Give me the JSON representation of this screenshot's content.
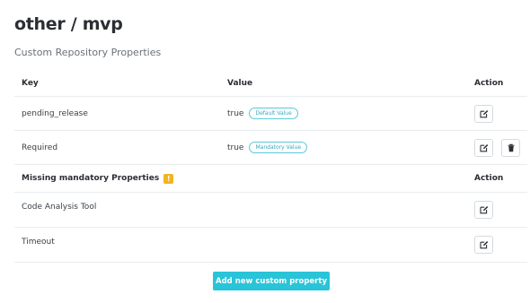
{
  "page": {
    "title": "other / mvp",
    "subtitle": "Custom Repository Properties"
  },
  "table": {
    "headers": {
      "key": "Key",
      "value": "Value",
      "action": "Action"
    },
    "rows": [
      {
        "key": "pending_release",
        "value": "true",
        "badge": "Default Value"
      },
      {
        "key": "Required",
        "value": "true",
        "badge": "Mandatory Value"
      }
    ]
  },
  "missing": {
    "title": "Missing mandatory Properties",
    "warning_icon": "!",
    "action_header": "Action",
    "rows": [
      {
        "key": "Code Analysis Tool"
      },
      {
        "key": "Timeout"
      }
    ]
  },
  "actions": {
    "add_label": "Add new custom property"
  },
  "icons": {
    "edit": "edit-icon",
    "delete": "trash-icon",
    "warning": "warning-icon"
  },
  "colors": {
    "accent": "#29c4d8",
    "badge_border": "#5cc8d8",
    "warning": "#f2b51e"
  }
}
